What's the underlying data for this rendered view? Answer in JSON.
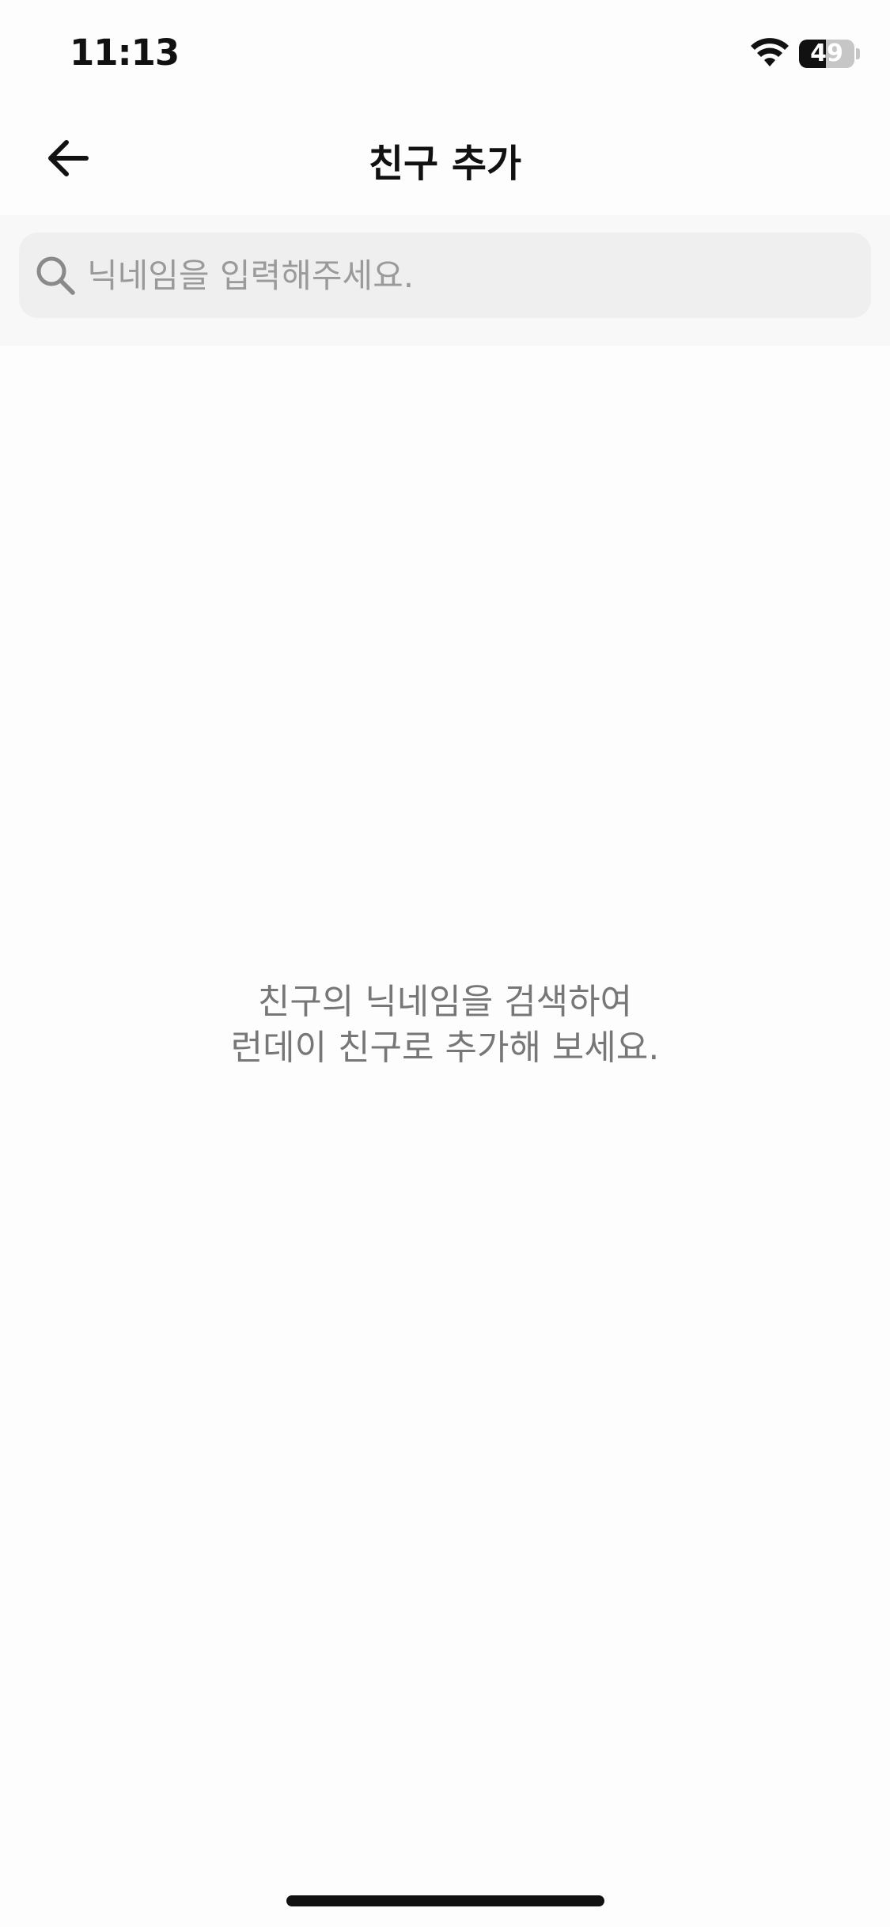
{
  "status_bar": {
    "time": "11:13",
    "battery_level": "49",
    "battery_fraction": 0.49,
    "wifi_icon": "wifi-icon"
  },
  "header": {
    "back_icon": "arrow-left-icon",
    "title": "친구 추가"
  },
  "search": {
    "icon": "search-icon",
    "placeholder": "닉네임을 입력해주세요.",
    "value": ""
  },
  "empty_state": {
    "line1": "친구의 닉네임을 검색하여",
    "line2": "런데이 친구로 추가해 보세요."
  },
  "colors": {
    "background": "#fdfdfd",
    "search_field": "#efefef",
    "placeholder_text": "#9a9a9a",
    "empty_text": "#777777",
    "primary_text": "#111111"
  }
}
